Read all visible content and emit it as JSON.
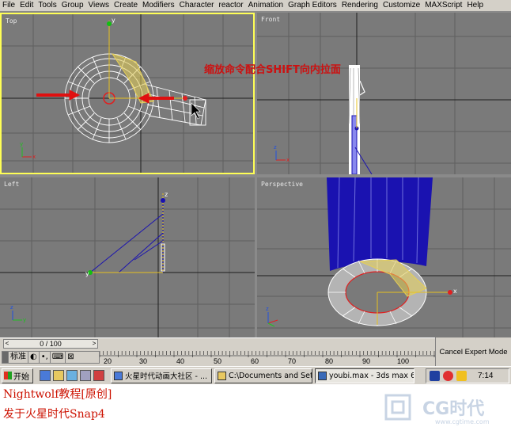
{
  "menu": [
    "File",
    "Edit",
    "Tools",
    "Group",
    "Views",
    "Create",
    "Modifiers",
    "Character",
    "reactor",
    "Animation",
    "Graph Editors",
    "Rendering",
    "Customize",
    "MAXScript",
    "Help"
  ],
  "viewports": {
    "top": "Top",
    "front": "Front",
    "left": "Left",
    "perspective": "Perspective"
  },
  "annotation": "缩放命令配合SHIFT向内拉面",
  "axis": {
    "x": "x",
    "y": "y",
    "z": "z"
  },
  "time_slider": {
    "value": "0 / 100",
    "prev": "<",
    "next": ">"
  },
  "ruler_numbers": [
    "20",
    "30",
    "40",
    "50",
    "60",
    "70",
    "80",
    "90",
    "100"
  ],
  "expert_button": "Cancel Expert Mode",
  "ime": {
    "mode": "标准",
    "glyphs": [
      "◐",
      "•,",
      "⌨",
      "⊠"
    ]
  },
  "taskbar": {
    "start": "开始",
    "tasks": [
      "火星时代动画大社区 - ...",
      "C:\\Documents and Setti...",
      "youbi.max - 3ds max 6 - ..."
    ],
    "clock": "7:14"
  },
  "caption": {
    "line1": "Nightwolf教程[原创]",
    "line2": "发于火星时代Snap4",
    "logo_text": "CG时代",
    "logo_url": "www.cgtime.com"
  },
  "colors": {
    "viewport_bg": "#7a7a7a",
    "active_border": "#ffff55",
    "annotation": "#cc1111",
    "caption": "#cc1100",
    "mesh_blue": "#1a12b0"
  }
}
